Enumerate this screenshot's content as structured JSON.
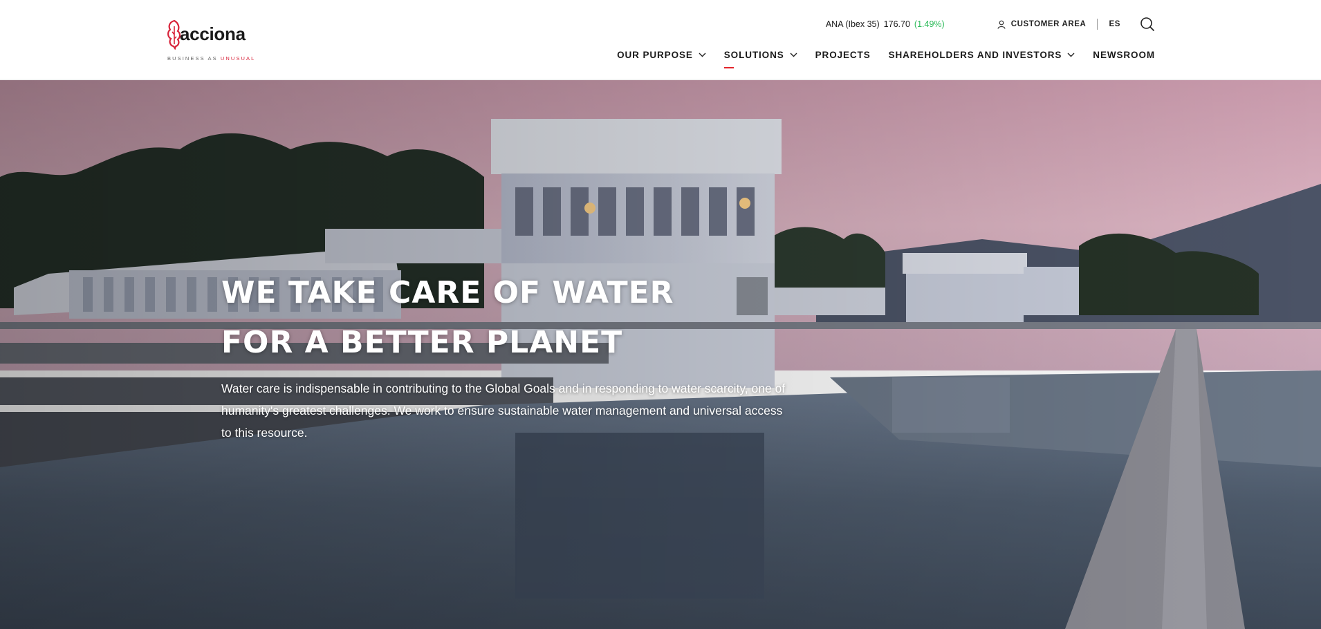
{
  "brand": {
    "logo_text": "acciona",
    "tagline_left": "BUSINESS AS ",
    "tagline_right": "UNUSUAL",
    "accent_color": "#e3242b"
  },
  "topbar": {
    "stock_label": "ANA (Ibex 35)",
    "stock_price": "176.70",
    "stock_change": "(1.49%)",
    "customer_area": "CUSTOMER AREA",
    "language": "ES",
    "search_icon": "search-icon"
  },
  "nav": {
    "items": [
      {
        "label": "OUR PURPOSE",
        "has_dropdown": true
      },
      {
        "label": "SOLUTIONS",
        "has_dropdown": true,
        "active": true
      },
      {
        "label": "PROJECTS",
        "has_dropdown": false
      },
      {
        "label": "SHAREHOLDERS AND INVESTORS",
        "has_dropdown": true
      },
      {
        "label": "NEWSROOM",
        "has_dropdown": false
      }
    ]
  },
  "hero": {
    "title": "WE TAKE CARE OF WATER FOR A BETTER PLANET",
    "description": "Water care is indispensable in contributing to the Global Goals and in responding to water scarcity, one of humanity's greatest challenges. We work to ensure sustainable water management and universal access to this resource."
  }
}
